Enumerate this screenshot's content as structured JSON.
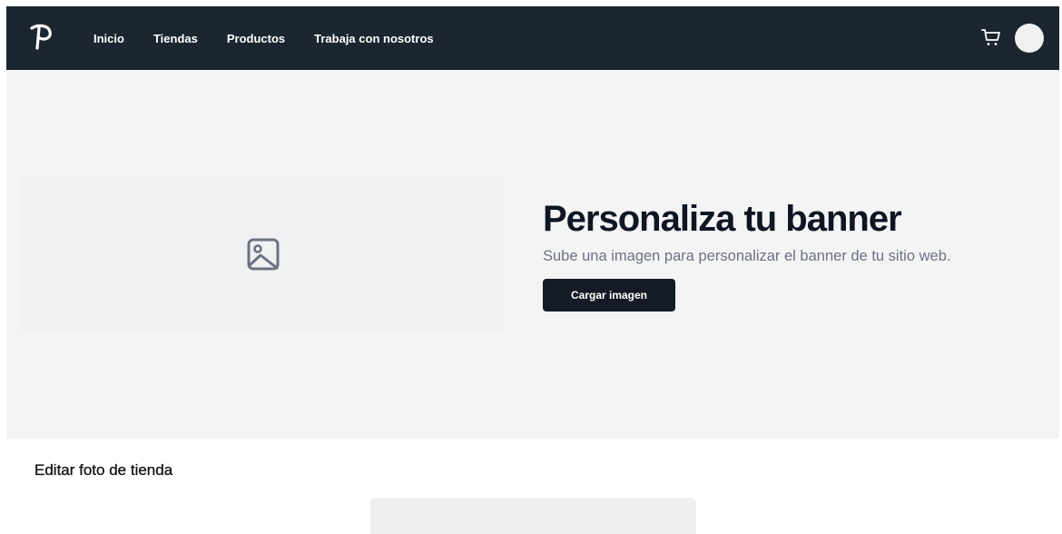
{
  "navbar": {
    "background": "#1b2631",
    "logo_icon": "brand-p-logo-icon",
    "links": [
      {
        "label": "Inicio"
      },
      {
        "label": "Tiendas"
      },
      {
        "label": "Productos"
      },
      {
        "label": "Trabaja con nosotros"
      }
    ],
    "cart_icon": "shopping-cart-icon"
  },
  "hero": {
    "background": "#f4f4f5",
    "image_icon": "image-placeholder-icon",
    "title": "Personaliza tu banner",
    "subtitle": "Sube una imagen para personalizar el banner de tu sitio web.",
    "upload_label": "Cargar imagen",
    "button_color": "#141a26"
  },
  "store_photo": {
    "title": "Editar foto de tienda"
  }
}
